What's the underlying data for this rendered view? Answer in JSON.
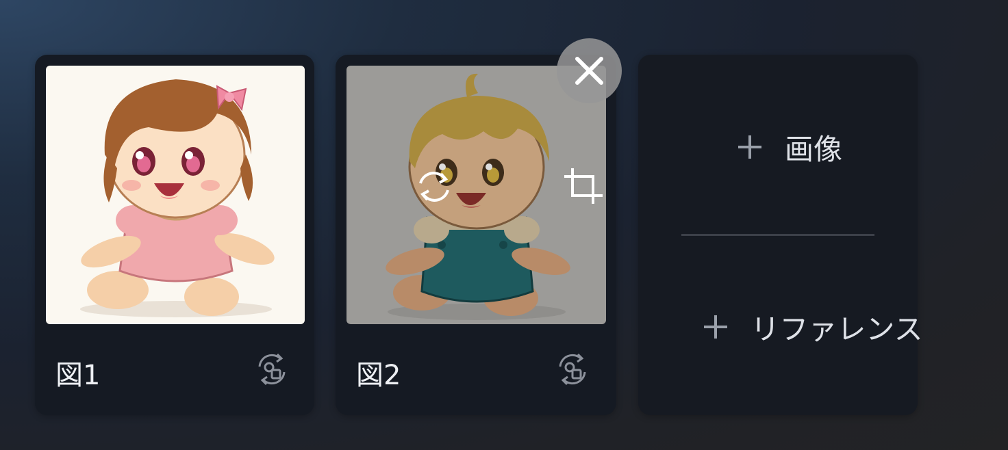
{
  "cards": [
    {
      "caption": "図1",
      "image": "baby-girl-pink-dress-illustration",
      "swap_icon": "swap-icon"
    },
    {
      "caption": "図2",
      "image": "baby-boy-teal-overalls-illustration",
      "swap_icon": "swap-icon",
      "hover_actions": {
        "replace_icon": "replace-icon",
        "crop_icon": "crop-icon"
      },
      "close_icon": "close-icon"
    }
  ],
  "add_panel": {
    "image_label": "画像",
    "reference_label": "リファレンス",
    "plus_icon": "plus-icon"
  },
  "colors": {
    "card_bg": "#151a23",
    "thumb1_bg": "#fbf8f1",
    "thumb2_bg": "#9c9b98",
    "text": "#eef0f4",
    "close_bg": "#969696"
  }
}
